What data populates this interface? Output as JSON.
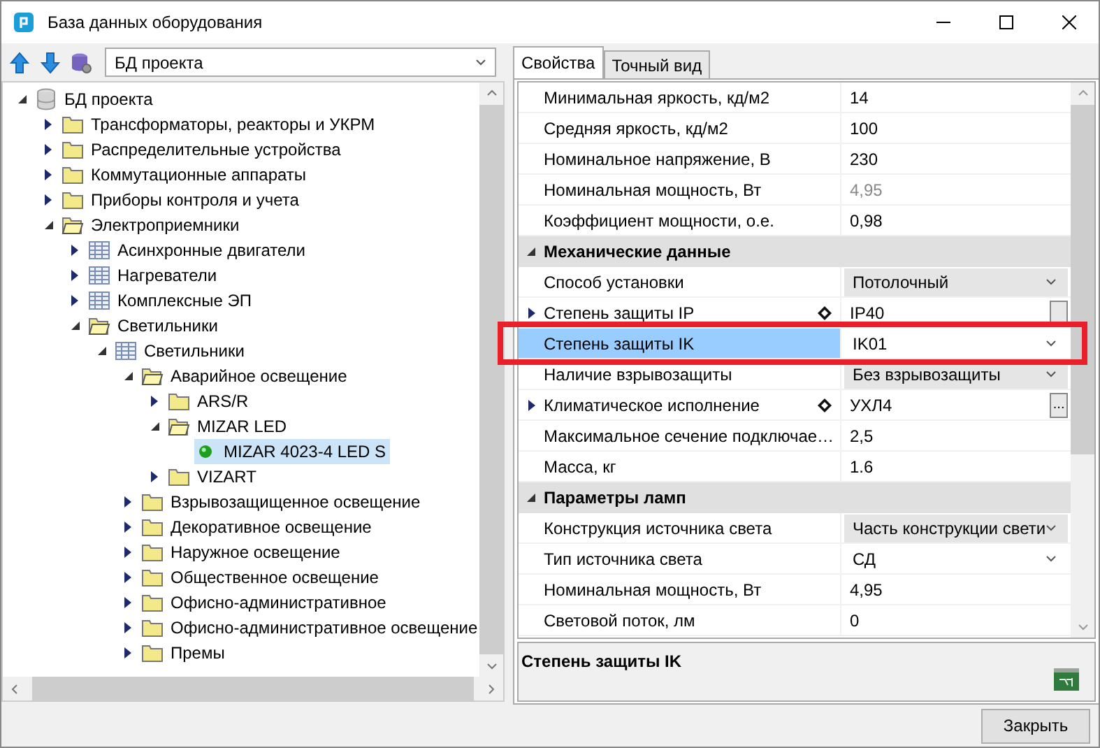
{
  "window": {
    "title": "База данных оборудования"
  },
  "toolbar": {
    "database_combo": "БД проекта"
  },
  "tree": [
    {
      "label": "БД проекта",
      "kind": "database",
      "expanded": true,
      "selected": false,
      "children": [
        {
          "label": "Трансформаторы, реакторы и УКРМ",
          "kind": "folder",
          "expanded": false,
          "selected": false
        },
        {
          "label": "Распределительные устройства",
          "kind": "folder",
          "expanded": false,
          "selected": false
        },
        {
          "label": "Коммутационные аппараты",
          "kind": "folder",
          "expanded": false,
          "selected": false
        },
        {
          "label": "Приборы контроля и учета",
          "kind": "folder",
          "expanded": false,
          "selected": false
        },
        {
          "label": "Электроприемники",
          "kind": "folder",
          "expanded": true,
          "selected": false,
          "children": [
            {
              "label": "Асинхронные двигатели",
              "kind": "table",
              "expanded": false,
              "selected": false
            },
            {
              "label": "Нагреватели",
              "kind": "table",
              "expanded": false,
              "selected": false
            },
            {
              "label": "Комплексные ЭП",
              "kind": "table",
              "expanded": false,
              "selected": false
            },
            {
              "label": "Светильники",
              "kind": "folder",
              "expanded": true,
              "selected": false,
              "children": [
                {
                  "label": "Светильники",
                  "kind": "table",
                  "expanded": true,
                  "selected": false,
                  "children": [
                    {
                      "label": "Аварийное освещение",
                      "kind": "folder",
                      "expanded": true,
                      "selected": false,
                      "children": [
                        {
                          "label": "ARS/R",
                          "kind": "folder",
                          "expanded": false,
                          "selected": false
                        },
                        {
                          "label": "MIZAR LED",
                          "kind": "folder",
                          "expanded": true,
                          "selected": false,
                          "children": [
                            {
                              "label": "MIZAR 4023-4 LED S",
                              "kind": "dot",
                              "selected": true
                            }
                          ]
                        },
                        {
                          "label": "VIZART",
                          "kind": "folder",
                          "expanded": false,
                          "selected": false
                        }
                      ]
                    },
                    {
                      "label": "Взрывозащищенное освещение",
                      "kind": "folder",
                      "expanded": false,
                      "selected": false
                    },
                    {
                      "label": "Декоративное освещение",
                      "kind": "folder",
                      "expanded": false,
                      "selected": false
                    },
                    {
                      "label": "Наружное освещение",
                      "kind": "folder",
                      "expanded": false,
                      "selected": false
                    },
                    {
                      "label": "Общественное освещение",
                      "kind": "folder",
                      "expanded": false,
                      "selected": false
                    },
                    {
                      "label": "Офисно-административное",
                      "kind": "folder",
                      "expanded": false,
                      "selected": false
                    },
                    {
                      "label": "Офисно-административное освещение",
                      "kind": "folder",
                      "expanded": false,
                      "selected": false
                    },
                    {
                      "label": "Премы",
                      "kind": "folder",
                      "expanded": false,
                      "selected": false
                    }
                  ]
                }
              ]
            }
          ]
        }
      ]
    }
  ],
  "tabs": [
    {
      "label": "Свойства",
      "selected": true
    },
    {
      "label": "Точный вид",
      "selected": false
    }
  ],
  "properties": [
    {
      "rows": [
        {
          "name": "Минимальная яркость, кд/м2",
          "value": "14",
          "kind": "text",
          "muted": false,
          "selected": false
        },
        {
          "name": "Средняя яркость, кд/м2",
          "value": "100",
          "kind": "text",
          "muted": false,
          "selected": false
        },
        {
          "name": "Номинальное напряжение, В",
          "value": "230",
          "kind": "text",
          "muted": false,
          "selected": false
        },
        {
          "name": "Номинальная мощность, Вт",
          "value": "4,95",
          "kind": "text",
          "muted": true,
          "selected": false
        },
        {
          "name": "Коэффициент мощности, о.е.",
          "value": "0,98",
          "kind": "text",
          "muted": false,
          "selected": false
        }
      ]
    },
    {
      "title": "Механические данные",
      "expanded": true,
      "rows": [
        {
          "name": "Способ установки",
          "value": "Потолочный",
          "kind": "combo",
          "muted": false,
          "selected": false
        },
        {
          "name": "Степень защиты IP",
          "value": "IP40",
          "kind": "ellipsis",
          "muted": false,
          "selected": false,
          "expandable": true,
          "diamond": true
        },
        {
          "name": "Степень защиты IK",
          "value": "IK01",
          "kind": "dropdown",
          "muted": false,
          "selected": true
        },
        {
          "name": "Наличие взрывозащиты",
          "value": "Без взрывозащиты",
          "kind": "combo",
          "muted": false,
          "selected": false
        },
        {
          "name": "Климатическое исполнение",
          "value": "УХЛ4",
          "kind": "ellipsis",
          "button_label": "...",
          "muted": false,
          "selected": false,
          "expandable": true,
          "diamond": true
        },
        {
          "name": "Максимальное сечение подключае…",
          "value": "2,5",
          "kind": "text",
          "muted": false,
          "selected": false
        },
        {
          "name": "Масса, кг",
          "value": "1.6",
          "kind": "text",
          "muted": false,
          "selected": false
        }
      ]
    },
    {
      "title": "Параметры ламп",
      "expanded": true,
      "rows": [
        {
          "name": "Конструкция источника света",
          "value": "Часть конструкции свети",
          "kind": "combo",
          "muted": false,
          "selected": false
        },
        {
          "name": "Тип источника света",
          "value": "СД",
          "kind": "dropdown",
          "muted": false,
          "selected": false
        },
        {
          "name": "Номинальная мощность, Вт",
          "value": "4,95",
          "kind": "text",
          "muted": false,
          "selected": false
        },
        {
          "name": "Световой поток, лм",
          "value": "0",
          "kind": "text",
          "muted": false,
          "selected": false
        }
      ]
    }
  ],
  "description": {
    "title": "Степень защиты IK"
  },
  "buttons": [
    {
      "label": "Закрыть"
    }
  ]
}
